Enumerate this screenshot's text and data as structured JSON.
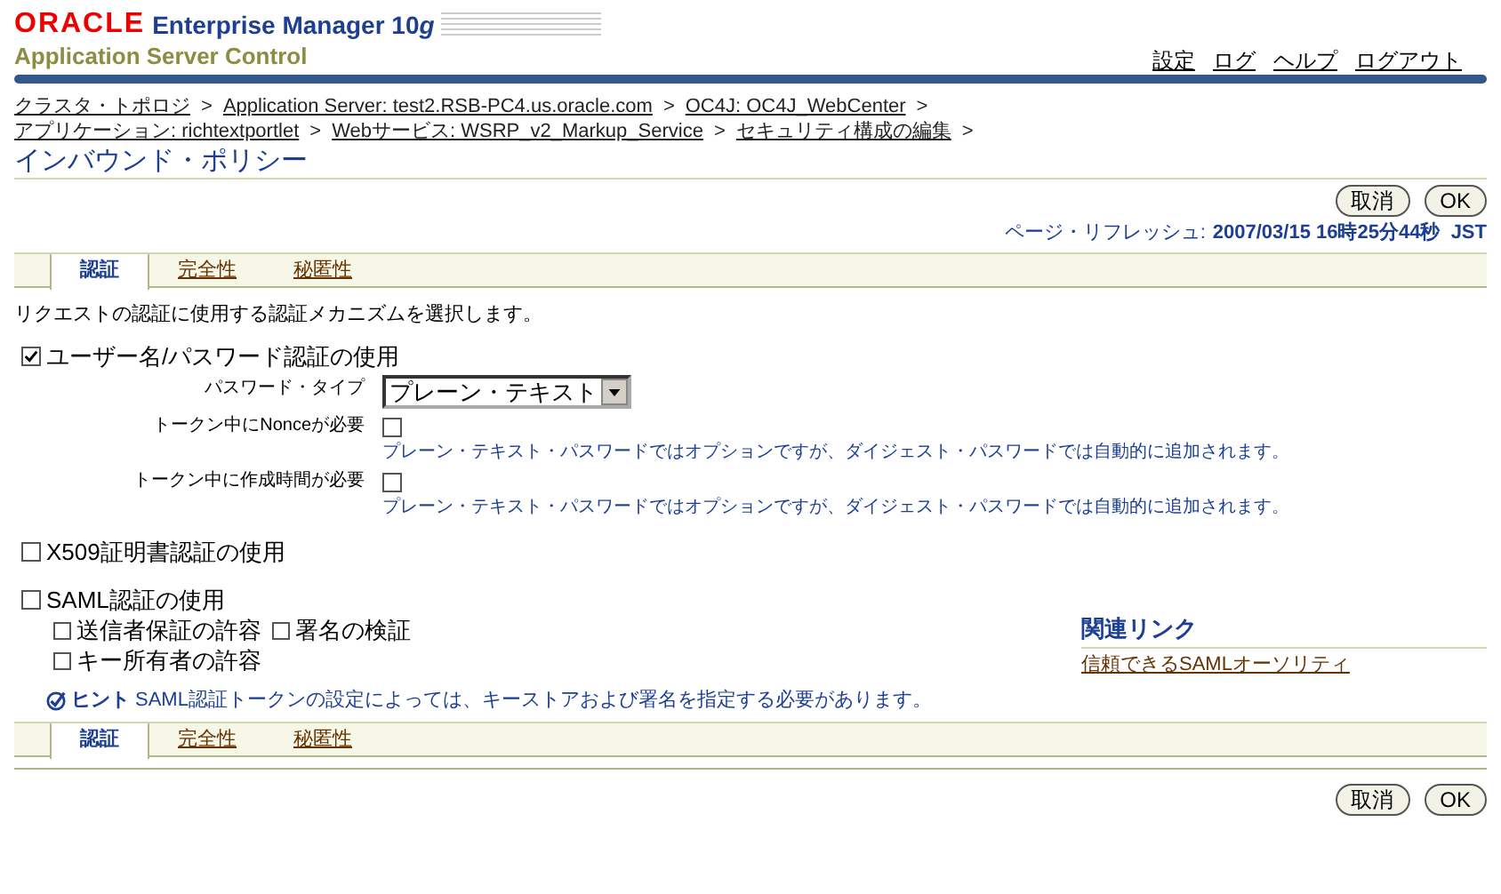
{
  "header": {
    "oracle": "ORACLE",
    "product": "Enterprise Manager 10",
    "product_suffix": "g",
    "subtitle": "Application Server Control",
    "global_links": [
      "設定",
      "ログ",
      "ヘルプ",
      "ログアウト"
    ]
  },
  "breadcrumbs": [
    "クラスタ・トポロジ",
    "Application Server: test2.RSB-PC4.us.oracle.com",
    "OC4J: OC4J_WebCenter",
    "アプリケーション: richtextportlet",
    "Webサービス: WSRP_v2_Markup_Service",
    "セキュリティ構成の編集"
  ],
  "breadcrumb_separator": ">",
  "page_title": "インバウンド・ポリシー",
  "top_buttons": [
    "取消",
    "OK"
  ],
  "refresh": {
    "label": "ページ・リフレッシュ:",
    "value": "2007/03/15 16時25分44秒  JST"
  },
  "tabs": [
    {
      "label": "認証",
      "selected": true
    },
    {
      "label": "完全性",
      "selected": false
    },
    {
      "label": "秘匿性",
      "selected": false
    }
  ],
  "description": "リクエストの認証に使用する認証メカニズムを選択します。",
  "sections": [
    {
      "label": "ユーザー名/パスワード認証の使用",
      "checked": true,
      "fields": [
        {
          "kind": "select",
          "label": "パスワード・タイプ",
          "value": "プレーン・テキスト"
        },
        {
          "kind": "checkbox",
          "label": "トークン中にNonceが必要",
          "checked": false,
          "hint": "プレーン・テキスト・パスワードではオプションですが、ダイジェスト・パスワードでは自動的に追加されます。"
        },
        {
          "kind": "checkbox",
          "label": "トークン中に作成時間が必要",
          "checked": false,
          "hint": "プレーン・テキスト・パスワードではオプションですが、ダイジェスト・パスワードでは自動的に追加されます。"
        }
      ]
    },
    {
      "label": "X509証明書認証の使用",
      "checked": false
    },
    {
      "label": "SAML認証の使用",
      "checked": false,
      "option_rows": [
        [
          {
            "label": "送信者保証の許容",
            "checked": false
          },
          {
            "label": "署名の検証",
            "checked": false
          }
        ],
        [
          {
            "label": "キー所有者の許容",
            "checked": false
          }
        ]
      ]
    }
  ],
  "related_links": {
    "title": "関連リンク",
    "links": [
      "信頼できるSAMLオーソリティ"
    ]
  },
  "tip": {
    "label": "ヒント",
    "text": "SAML認証トークンの設定によっては、キーストアおよび署名を指定する必要があります。"
  },
  "bottom_tabs": [
    {
      "label": "認証",
      "selected": true
    },
    {
      "label": "完全性",
      "selected": false
    },
    {
      "label": "秘匿性",
      "selected": false
    }
  ],
  "bottom_buttons": [
    "取消",
    "OK"
  ]
}
